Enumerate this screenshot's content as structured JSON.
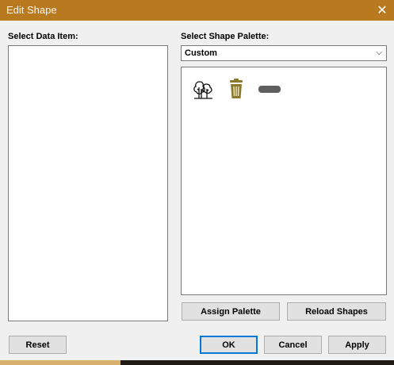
{
  "window": {
    "title": "Edit Shape",
    "close_glyph": "✕"
  },
  "left_panel": {
    "label": "Select Data Item:"
  },
  "right_panel": {
    "label": "Select Shape Palette:",
    "palette_select": {
      "value": "Custom",
      "chevron": "⌵"
    },
    "shapes": [
      {
        "icon": "trees-icon"
      },
      {
        "icon": "trash-bin-icon",
        "color": "#8b7a2e"
      },
      {
        "icon": "rounded-bar-icon",
        "color": "#5f5f5f"
      }
    ],
    "assign_palette_label": "Assign Palette",
    "reload_shapes_label": "Reload Shapes"
  },
  "footer": {
    "reset_label": "Reset",
    "ok_label": "OK",
    "cancel_label": "Cancel",
    "apply_label": "Apply"
  },
  "colors": {
    "titlebar": "#b97a1f",
    "focus": "#0078d7"
  }
}
